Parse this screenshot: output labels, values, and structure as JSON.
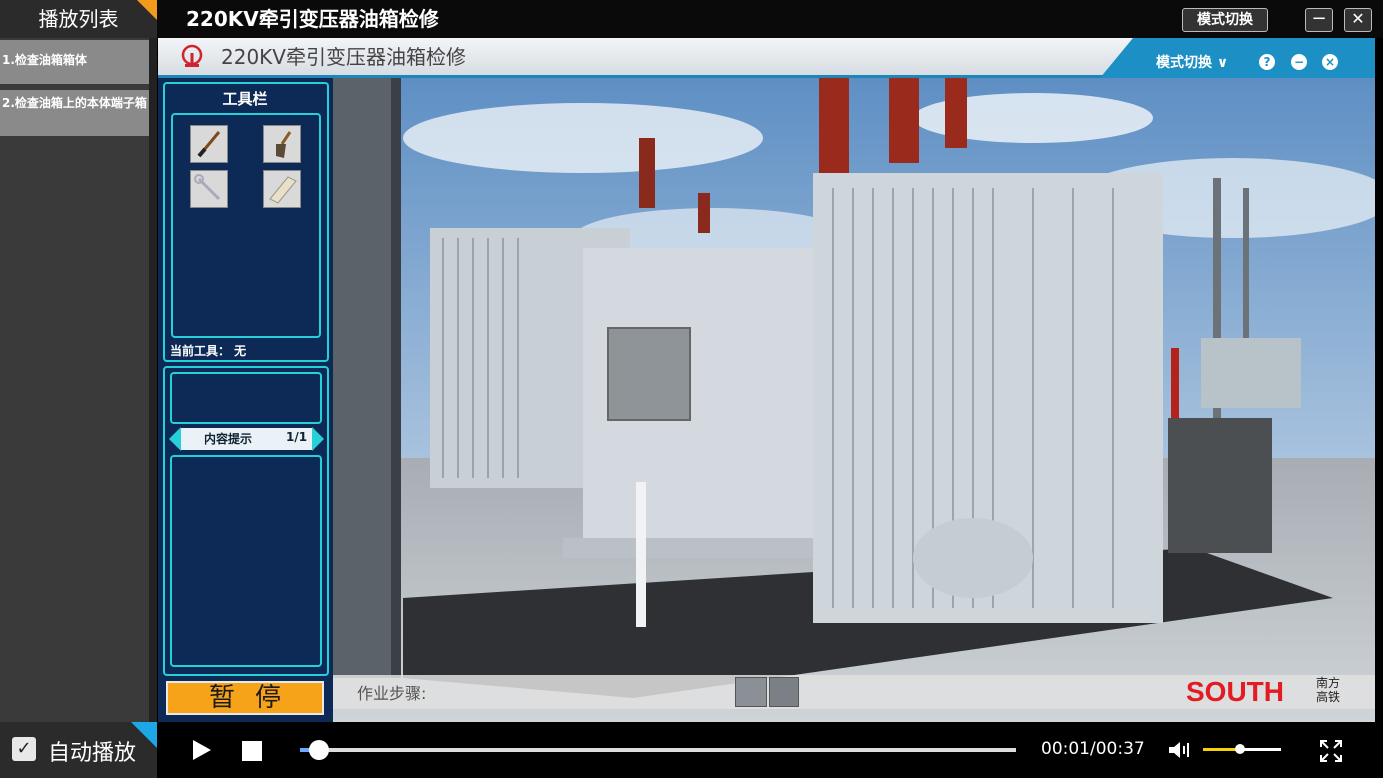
{
  "window": {
    "playlist_title": "播放列表",
    "title": "220KV牵引变压器油箱检修",
    "mode_button": "模式切换",
    "minimize_glyph": "−",
    "close_glyph": "✕"
  },
  "playlist": {
    "items": [
      {
        "label": "1.检查油箱箱体"
      },
      {
        "label": "2.检查油箱上的本体端子箱"
      }
    ]
  },
  "app_header": {
    "title": "220KV牵引变压器油箱检修",
    "mode_switch": "模式切换 ∨",
    "help_glyph": "?",
    "minimize_glyph": "−",
    "close_glyph": "×",
    "accent_color": "#1c8fc4"
  },
  "tool_panel": {
    "title": "工具栏",
    "tools": [
      {
        "icon": "screwdriver-icon"
      },
      {
        "icon": "brush-icon"
      },
      {
        "icon": "wrench-icon"
      },
      {
        "icon": "cloth-icon"
      }
    ],
    "current_tool": "当前工具：  无",
    "hint_label": "内容提示",
    "hint_page": "1/1",
    "pause_label": "暂停",
    "border_color": "#26d0d8"
  },
  "scene": {
    "steps_label": "作业步骤:",
    "brand": "SOUTH",
    "brand_sub": "南方 高铁"
  },
  "player": {
    "autoplay_label": "自动播放",
    "autoplay_checked": true,
    "time": "00:01/00:37",
    "progress": 0.027,
    "volume": 0.48
  }
}
